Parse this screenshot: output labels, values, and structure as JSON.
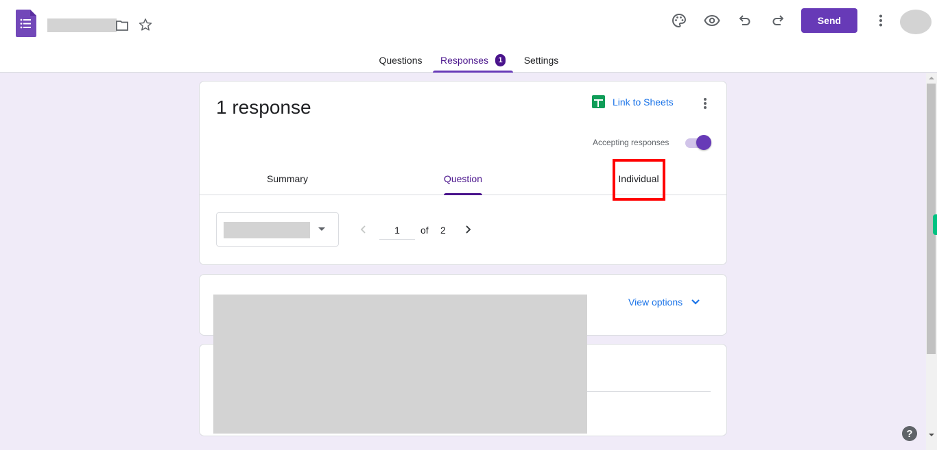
{
  "header": {
    "app_icon": "google-forms-icon",
    "title": "",
    "icons": [
      "folder-icon",
      "star-icon",
      "palette-icon",
      "eye-icon",
      "undo-icon",
      "redo-icon",
      "more-vert-icon"
    ],
    "send_label": "Send"
  },
  "main_tabs": [
    {
      "label": "Questions",
      "active": false
    },
    {
      "label": "Responses",
      "active": true,
      "badge": "1"
    },
    {
      "label": "Settings",
      "active": false
    }
  ],
  "responses": {
    "title": "1 response",
    "link_to_sheets_label": "Link to Sheets",
    "accepting_label": "Accepting responses",
    "accepting_on": true,
    "sub_tabs": [
      {
        "label": "Summary",
        "active": false
      },
      {
        "label": "Question",
        "active": true
      },
      {
        "label": "Individual",
        "active": false,
        "highlighted": true
      }
    ],
    "question_select_value": "",
    "pager": {
      "current": "1",
      "of_label": "of",
      "total": "2"
    }
  },
  "question_card": {
    "view_options_label": "View options"
  },
  "help_label": "?",
  "colors": {
    "accent": "#673ab7",
    "accent_dark": "#4a148c",
    "link": "#1a73e8",
    "background": "#f0ebf8",
    "highlight": "#ff0000",
    "sheets_green": "#0f9d58"
  }
}
